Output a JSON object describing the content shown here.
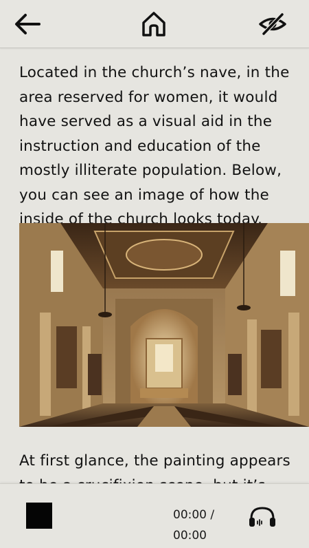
{
  "header": {
    "back_icon": "arrow-left-icon",
    "home_icon": "home-icon",
    "visibility_icon": "eye-off-icon"
  },
  "article": {
    "paragraph1": "Located in the church’s nave, in the area reserved for women, it would have served as a visual aid in the instruction and education of the mostly illiterate population. Below, you can see an image of how the inside of the church looks today.",
    "paragraph2": "At first glance, the painting appears to be a crucifixion scene, but it’s"
  },
  "player": {
    "stop_icon": "stop-icon",
    "time_current": "00:00 /",
    "time_total": "00:00",
    "audio_icon": "headphones-icon"
  },
  "colors": {
    "background": "#e6e5e0",
    "text": "#121212",
    "accent": "#050505"
  }
}
